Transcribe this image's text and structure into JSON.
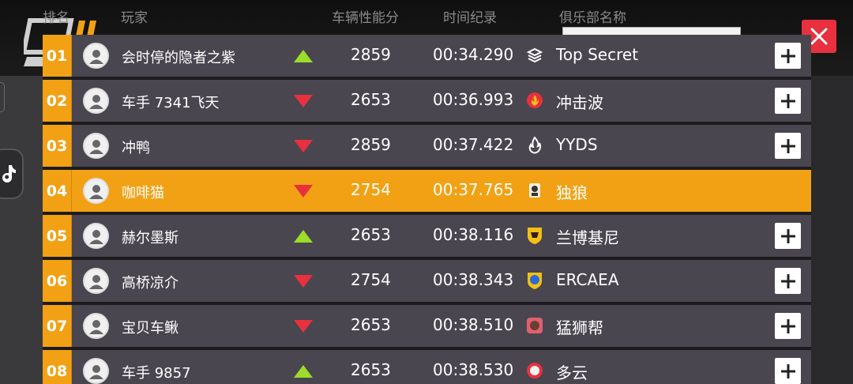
{
  "colors": {
    "accent": "#f2a114",
    "row_bg": "#4a4650",
    "up": "#9cdc2a",
    "down": "#e8303e",
    "close_bg": "#e8303e"
  },
  "header": {
    "rank": "排名",
    "player": "玩家",
    "performance": "车辆性能分",
    "time": "时间纪录",
    "club": "俱乐部名称"
  },
  "rows": [
    {
      "rank": "01",
      "name": "会时停的隐者之紫",
      "trend": "up",
      "score": "2859",
      "time": "00:34.290",
      "club": "Top Secret",
      "club_icon": "layers-icon",
      "highlight": false
    },
    {
      "rank": "02",
      "name": "车手 7341飞天",
      "trend": "down",
      "score": "2653",
      "time": "00:36.993",
      "club": "冲击波",
      "club_icon": "flame-badge-icon",
      "highlight": false
    },
    {
      "rank": "03",
      "name": "冲鸭",
      "trend": "down",
      "score": "2859",
      "time": "00:37.422",
      "club": "YYDS",
      "club_icon": "fire-icon",
      "highlight": false
    },
    {
      "rank": "04",
      "name": "咖啡猫",
      "trend": "down",
      "score": "2754",
      "time": "00:37.765",
      "club": "独狼",
      "club_icon": "wolf-icon",
      "highlight": true
    },
    {
      "rank": "05",
      "name": "赫尔墨斯",
      "trend": "up",
      "score": "2653",
      "time": "00:38.116",
      "club": "兰博基尼",
      "club_icon": "bull-shield-icon",
      "highlight": false
    },
    {
      "rank": "06",
      "name": "高桥凉介",
      "trend": "down",
      "score": "2754",
      "time": "00:38.343",
      "club": "ERCAEA",
      "club_icon": "shield-icon",
      "highlight": false
    },
    {
      "rank": "07",
      "name": "宝贝车鳅",
      "trend": "down",
      "score": "2653",
      "time": "00:38.510",
      "club": "猛狮帮",
      "club_icon": "lion-icon",
      "highlight": false
    },
    {
      "rank": "08",
      "name": "车手 9857",
      "trend": "up",
      "score": "2653",
      "time": "00:38.530",
      "club": "多云",
      "club_icon": "cloud-emblem-icon",
      "highlight": false
    }
  ]
}
